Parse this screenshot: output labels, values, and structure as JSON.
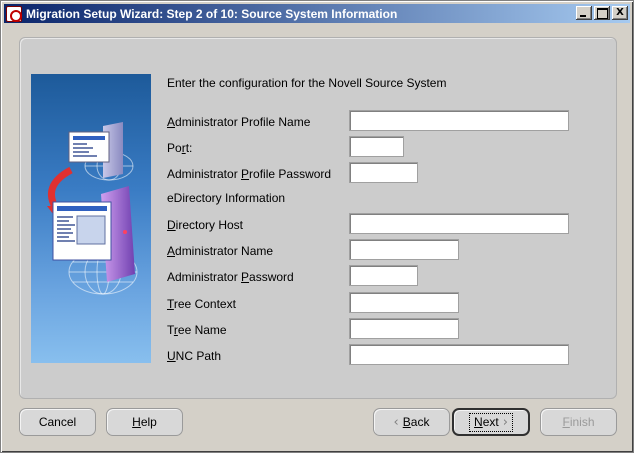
{
  "window": {
    "title": "Migration Setup Wizard:  Step 2 of 10: Source System Information",
    "minimize_icon": "minimize-icon",
    "maximize_icon": "maximize-icon",
    "close_glyph": "X"
  },
  "form": {
    "heading": "Enter the configuration for the Novell Source System",
    "admin_profile_name": {
      "mnemonic": "A",
      "rest": "dministrator Profile Name",
      "value": ""
    },
    "port": {
      "pre": "Po",
      "mnemonic": "r",
      "post": "t:",
      "value": ""
    },
    "admin_profile_password": {
      "pre": "Administrator ",
      "mnemonic": "P",
      "post": "rofile Password",
      "value": ""
    },
    "edirectory_section": "eDirectory Information",
    "directory_host": {
      "mnemonic": "D",
      "rest": "irectory Host",
      "value": ""
    },
    "admin_name": {
      "mnemonic": "A",
      "rest": "dministrator Name",
      "value": ""
    },
    "admin_password": {
      "pre": "Administrator ",
      "mnemonic": "P",
      "post": "assword",
      "value": ""
    },
    "tree_context": {
      "mnemonic": "T",
      "rest": "ree Context",
      "value": ""
    },
    "tree_name": {
      "pre": "T",
      "mnemonic": "r",
      "post": "ee Name",
      "value": ""
    },
    "unc_path": {
      "mnemonic": "U",
      "rest": "NC Path",
      "value": ""
    }
  },
  "buttons": {
    "cancel": "Cancel",
    "help": {
      "mnemonic": "H",
      "rest": "elp"
    },
    "back": {
      "mnemonic": "B",
      "rest": "ack"
    },
    "next": {
      "mnemonic": "N",
      "rest": "ext"
    },
    "finish": {
      "mnemonic": "F",
      "rest": "inish"
    }
  },
  "icons": {
    "back_chevron": "chevron-left-icon",
    "next_chevron": "chevron-right-icon"
  }
}
